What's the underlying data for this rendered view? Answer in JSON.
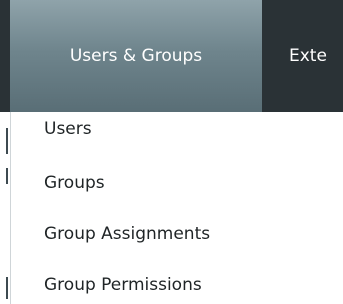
{
  "navbar": {
    "tabs": [
      {
        "label": "Users & Groups",
        "active": true
      },
      {
        "label": "Exte",
        "active": false
      }
    ]
  },
  "dropdown": {
    "items": [
      {
        "label": "Users"
      },
      {
        "label": "Groups"
      },
      {
        "label": "Group Assignments"
      },
      {
        "label": "Group Permissions"
      }
    ]
  },
  "colors": {
    "navbar_bg": "#2a3236",
    "active_tab_top": "#8fa3aa",
    "active_tab_bottom": "#596e76",
    "menu_text": "#1f2426",
    "tab_text": "#ffffff"
  }
}
